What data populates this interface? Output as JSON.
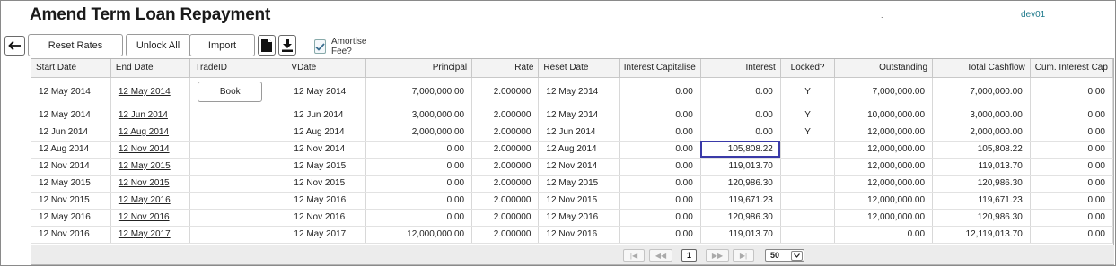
{
  "header": {
    "title": "Amend Term Loan Repayment",
    "dot": ".",
    "env": "dev01"
  },
  "toolbar": {
    "reset_rates": "Reset Rates",
    "unlock_all": "Unlock All",
    "import": "Import",
    "amortise_fee_label": "Amortise Fee?",
    "amortise_fee_checked": true
  },
  "icons": [
    "arrow-left-icon",
    "document-icon",
    "download-icon",
    "checkmark-icon"
  ],
  "grid": {
    "columns": [
      "Start Date",
      "End Date",
      "TradeID",
      "VDate",
      "Principal",
      "Rate",
      "Reset Date",
      "Interest Capitalise",
      "Interest",
      "Locked?",
      "Outstanding",
      "Total Cashflow",
      "Cum. Interest Cap"
    ],
    "book_label": "Book",
    "rows": [
      [
        "12 May 2014",
        "12 May 2014",
        "",
        "12 May 2014",
        "7,000,000.00",
        "2.000000",
        "12 May 2014",
        "0.00",
        "0.00",
        "Y",
        "7,000,000.00",
        "7,000,000.00",
        "0.00"
      ],
      [
        "12 May 2014",
        "12 Jun 2014",
        "",
        "12 Jun 2014",
        "3,000,000.00",
        "2.000000",
        "12 May 2014",
        "0.00",
        "0.00",
        "Y",
        "10,000,000.00",
        "3,000,000.00",
        "0.00"
      ],
      [
        "12 Jun 2014",
        "12 Aug 2014",
        "",
        "12 Aug 2014",
        "2,000,000.00",
        "2.000000",
        "12 Jun 2014",
        "0.00",
        "0.00",
        "Y",
        "12,000,000.00",
        "2,000,000.00",
        "0.00"
      ],
      [
        "12 Aug 2014",
        "12 Nov 2014",
        "",
        "12 Nov 2014",
        "0.00",
        "2.000000",
        "12 Aug 2014",
        "0.00",
        "105,808.22",
        "",
        "12,000,000.00",
        "105,808.22",
        "0.00"
      ],
      [
        "12 Nov 2014",
        "12 May 2015",
        "",
        "12 May 2015",
        "0.00",
        "2.000000",
        "12 Nov 2014",
        "0.00",
        "119,013.70",
        "",
        "12,000,000.00",
        "119,013.70",
        "0.00"
      ],
      [
        "12 May 2015",
        "12 Nov 2015",
        "",
        "12 Nov 2015",
        "0.00",
        "2.000000",
        "12 May 2015",
        "0.00",
        "120,986.30",
        "",
        "12,000,000.00",
        "120,986.30",
        "0.00"
      ],
      [
        "12 Nov 2015",
        "12 May 2016",
        "",
        "12 May 2016",
        "0.00",
        "2.000000",
        "12 Nov 2015",
        "0.00",
        "119,671.23",
        "",
        "12,000,000.00",
        "119,671.23",
        "0.00"
      ],
      [
        "12 May 2016",
        "12 Nov 2016",
        "",
        "12 Nov 2016",
        "0.00",
        "2.000000",
        "12 May 2016",
        "0.00",
        "120,986.30",
        "",
        "12,000,000.00",
        "120,986.30",
        "0.00"
      ],
      [
        "12 Nov 2016",
        "12 May 2017",
        "",
        "12 May 2017",
        "12,000,000.00",
        "2.000000",
        "12 Nov 2016",
        "0.00",
        "119,013.70",
        "",
        "0.00",
        "12,119,013.70",
        "0.00"
      ]
    ]
  },
  "pager": {
    "first": "|◀",
    "prev": "◀◀",
    "current_page": "1",
    "next": "▶▶",
    "last": "▶|",
    "page_size": "50"
  }
}
